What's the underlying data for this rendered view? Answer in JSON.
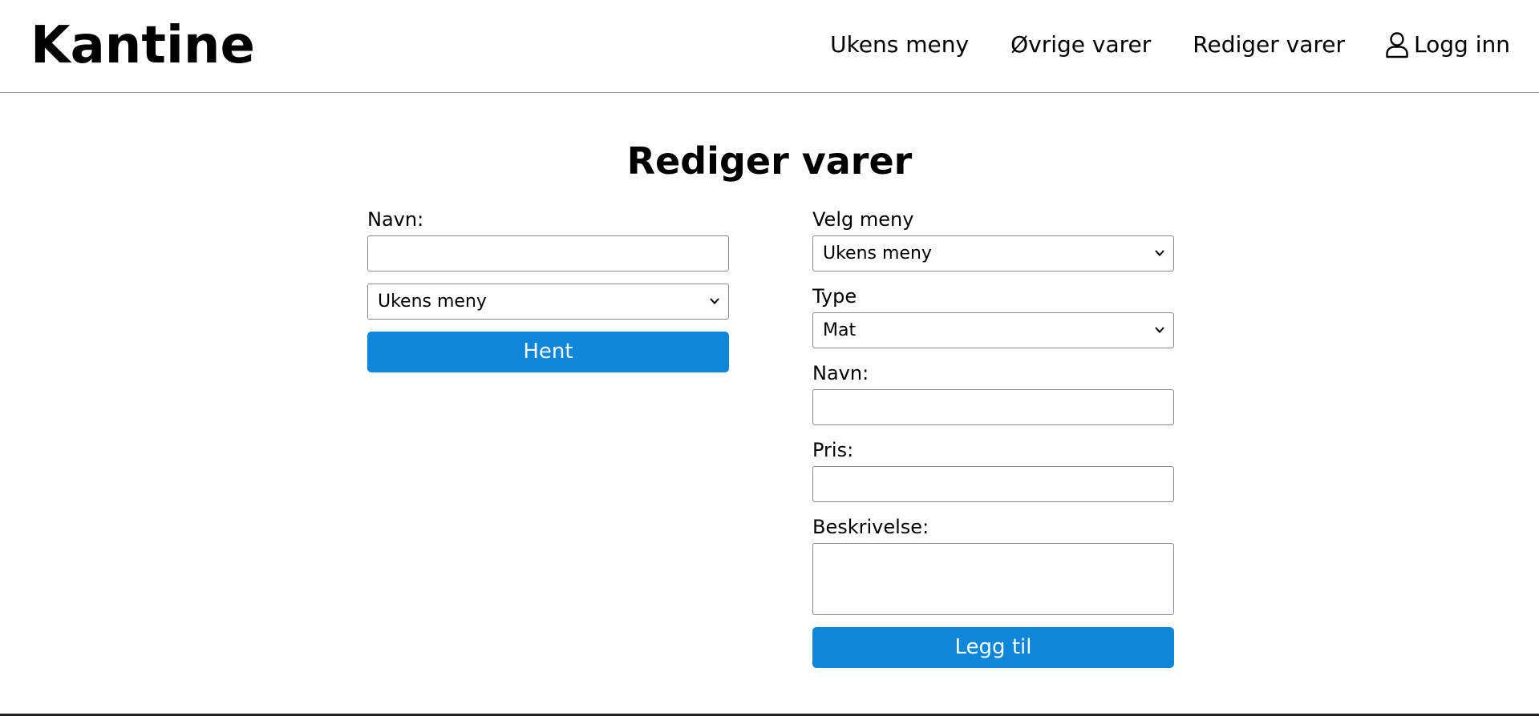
{
  "header": {
    "logo": "Kantine",
    "nav": {
      "items": [
        "Ukens meny",
        "Øvrige varer",
        "Rediger varer"
      ],
      "login_label": "Logg inn",
      "login_icon": "user-icon"
    }
  },
  "page": {
    "title": "Rediger varer"
  },
  "fetch_form": {
    "name_label": "Navn:",
    "name_value": "",
    "menu_select_value": "Ukens meny",
    "fetch_button": "Hent"
  },
  "add_form": {
    "menu_label": "Velg meny",
    "menu_select_value": "Ukens meny",
    "type_label": "Type",
    "type_select_value": "Mat",
    "name_label": "Navn:",
    "name_value": "",
    "price_label": "Pris:",
    "price_value": "",
    "description_label": "Beskrivelse:",
    "description_value": "",
    "add_button": "Legg til"
  },
  "colors": {
    "button_blue": "#0e86d9",
    "border_gray": "#8a8a8a",
    "text": "#000000",
    "background": "#ffffff"
  }
}
